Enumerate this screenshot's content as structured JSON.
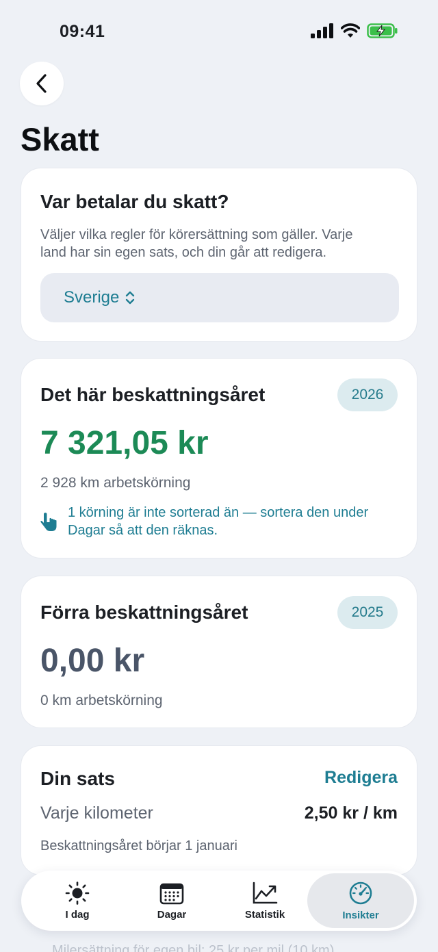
{
  "status": {
    "time": "09:41"
  },
  "page": {
    "title": "Skatt"
  },
  "tax_location": {
    "heading": "Var betalar du skatt?",
    "description_line1": "Väljer vilka regler för körersättning som gäller. Varje",
    "description_line2": "land har sin egen sats, och din går att redigera.",
    "selected_country": "Sverige"
  },
  "current_year": {
    "heading": "Det här beskattningsåret",
    "year": "2026",
    "amount": "7 321,05 kr",
    "distance": "2 928 km arbetskörning",
    "note_line1": "1 körning är inte sorterad än — sortera den under",
    "note_line2": "Dagar så att den räknas."
  },
  "previous_year": {
    "heading": "Förra beskattningsåret",
    "year": "2025",
    "amount": "0,00 kr",
    "distance": "0 km arbetskörning"
  },
  "rate": {
    "heading": "Din sats",
    "edit_label": "Redigera",
    "per_km_label": "Varje kilometer",
    "per_km_value": "2,50 kr / km",
    "year_start": "Beskattningsåret börjar 1 januari"
  },
  "peek_text": "Milersättning för egen bil: 25 kr per mil (10 km)",
  "tabs": [
    {
      "label": "I dag",
      "icon": "sun-icon"
    },
    {
      "label": "Dagar",
      "icon": "calendar-icon"
    },
    {
      "label": "Statistik",
      "icon": "chart-icon"
    },
    {
      "label": "Insikter",
      "icon": "gauge-icon",
      "active": true
    }
  ],
  "colors": {
    "accent": "#1e7d92",
    "positive": "#1c8a56",
    "background": "#eef1f6"
  }
}
